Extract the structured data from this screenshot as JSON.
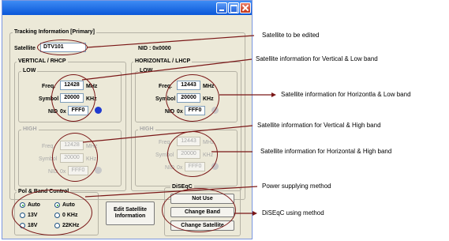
{
  "window": {
    "title": "",
    "tracking_title": "Tracking Information [Primary]",
    "satellite_label": "Satellite",
    "satellite_value": "DTV101",
    "nid_header": "NID : 0x0000"
  },
  "vertical": {
    "title": "VERTICAL / RHCP",
    "low_title": "LOW",
    "high_title": "HIGH",
    "low": {
      "freq_label": "Freq.",
      "freq_value": "12428",
      "freq_unit": "MHz",
      "symbol_label": "Symbol",
      "symbol_value": "20000",
      "symbol_unit": "KHz",
      "nid_label": "NID",
      "nid_prefix": "0x",
      "nid_value": "FFF0",
      "indicator_color": "#1f3ad0"
    },
    "high": {
      "freq_label": "Freq.",
      "freq_value": "12428",
      "freq_unit": "MHz",
      "symbol_label": "Symbol",
      "symbol_value": "20000",
      "symbol_unit": "KHz",
      "nid_label": "NID",
      "nid_prefix": "0x",
      "nid_value": "FFF0",
      "indicator_color": "#c8c8c8"
    }
  },
  "horizontal": {
    "title": "HORIZONTAL / LHCP",
    "low_title": "LOW",
    "high_title": "HIGH",
    "low": {
      "freq_label": "Freq.",
      "freq_value": "12443",
      "freq_unit": "MHz",
      "symbol_label": "Symbol",
      "symbol_value": "20000",
      "symbol_unit": "KHz",
      "nid_label": "NID",
      "nid_prefix": "0x",
      "nid_value": "FFF0",
      "indicator_color": "#c8c8c8"
    },
    "high": {
      "freq_label": "Freq.",
      "freq_value": "12443",
      "freq_unit": "MHz",
      "symbol_label": "Symbol",
      "symbol_value": "20000",
      "symbol_unit": "KHz",
      "nid_label": "NID",
      "nid_prefix": "0x",
      "nid_value": "FFF0",
      "indicator_color": "#c8c8c8"
    }
  },
  "pol_band": {
    "title": "Pol & Band Control",
    "options_left": [
      "Auto",
      "13V",
      "18V"
    ],
    "options_right": [
      "Auto",
      "0 KHz",
      "22KHz"
    ],
    "selected_left": "Auto",
    "selected_right": "Auto"
  },
  "edit_button": {
    "line1": "Edit Satellite",
    "line2": "Information"
  },
  "diseqc": {
    "title": "DiSEqC",
    "not_use": "Not Use",
    "change_band": "Change Band",
    "change_satellite": "Change Satellite"
  },
  "annotations": [
    "Satellite to be edited",
    "Satellite information for Vertical & Low band",
    "Satellite information for Horizontla & Low band",
    "Satellite information for Vertical & High band",
    "Satellite information for Horizontal & High band",
    "Power supplying method",
    "DiSEqC using method"
  ],
  "colors": {
    "annotation_line": "#7a1717",
    "window_bg": "#ece9d8",
    "titlebar": "#0a57d8"
  }
}
